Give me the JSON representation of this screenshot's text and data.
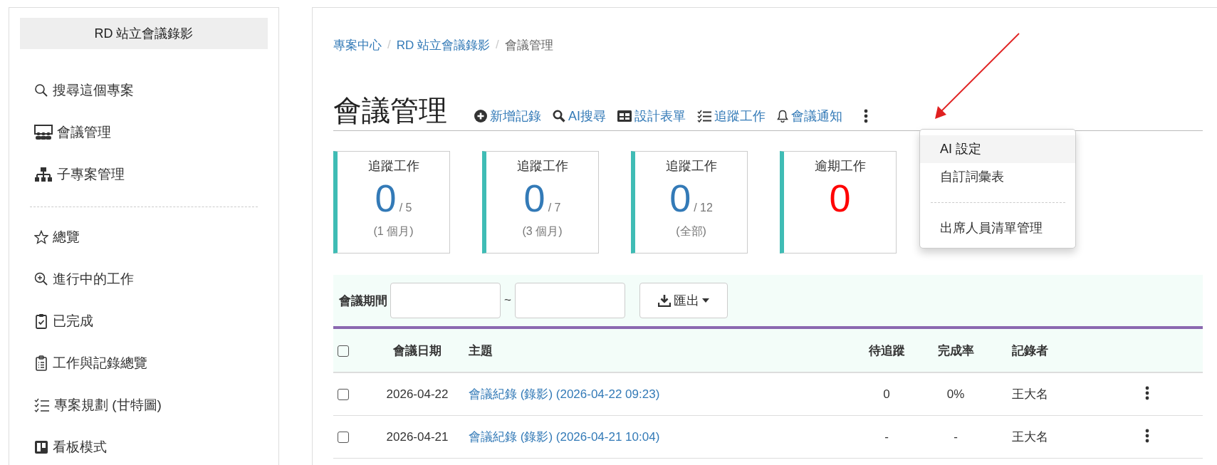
{
  "sidebar": {
    "title": "RD 站立會議錄影",
    "groups": [
      [
        {
          "label": "搜尋這個專案"
        },
        {
          "label": "會議管理"
        },
        {
          "label": "子專案管理"
        }
      ],
      [
        {
          "label": "總覽"
        },
        {
          "label": "進行中的工作"
        },
        {
          "label": "已完成"
        },
        {
          "label": "工作與記錄總覽"
        },
        {
          "label": "專案規劃 (甘特圖)"
        },
        {
          "label": "看板模式"
        }
      ]
    ]
  },
  "breadcrumb_separator": "/",
  "breadcrumb": [
    {
      "label": "專案中心",
      "current": false
    },
    {
      "label": "RD 站立會議錄影",
      "current": false
    },
    {
      "label": "會議管理",
      "current": true
    }
  ],
  "page_title": "會議管理",
  "actions": [
    {
      "label": "新增記錄"
    },
    {
      "label": "AI搜尋"
    },
    {
      "label": "設計表單"
    },
    {
      "label": "追蹤工作"
    },
    {
      "label": "會議通知"
    }
  ],
  "menu": {
    "groups": [
      [
        {
          "label": "AI 設定",
          "selected": true
        },
        {
          "label": "自訂詞彙表",
          "selected": false
        }
      ],
      [
        {
          "label": "出席人員清單管理",
          "selected": false
        }
      ]
    ]
  },
  "stats": [
    {
      "kind": "ratio",
      "title": "追蹤工作",
      "value": "0",
      "total": "/ 5",
      "note": "(1 個月)"
    },
    {
      "kind": "ratio",
      "title": "追蹤工作",
      "value": "0",
      "total": "/ 7",
      "note": "(3 個月)"
    },
    {
      "kind": "ratio",
      "title": "追蹤工作",
      "value": "0",
      "total": "/ 12",
      "note": "(全部)"
    },
    {
      "kind": "overdue",
      "title": "逾期工作",
      "value": "0"
    }
  ],
  "filter": {
    "label": "會議期間",
    "separator": "~",
    "export": "匯出"
  },
  "table": {
    "select_all": {
      "checked": false
    },
    "columns": [
      "會議日期",
      "主題",
      "待追蹤",
      "完成率",
      "記錄者"
    ],
    "rows": [
      {
        "checked": false,
        "date": "2026-04-22",
        "subject": "會議紀錄 (錄影) (2026-04-22 09:23)",
        "pending": "0",
        "rate": "0%",
        "recorder": "王大名"
      },
      {
        "checked": false,
        "date": "2026-04-21",
        "subject": "會議紀錄 (錄影) (2026-04-21 10:04)",
        "pending": "-",
        "rate": "-",
        "recorder": "王大名"
      }
    ]
  }
}
